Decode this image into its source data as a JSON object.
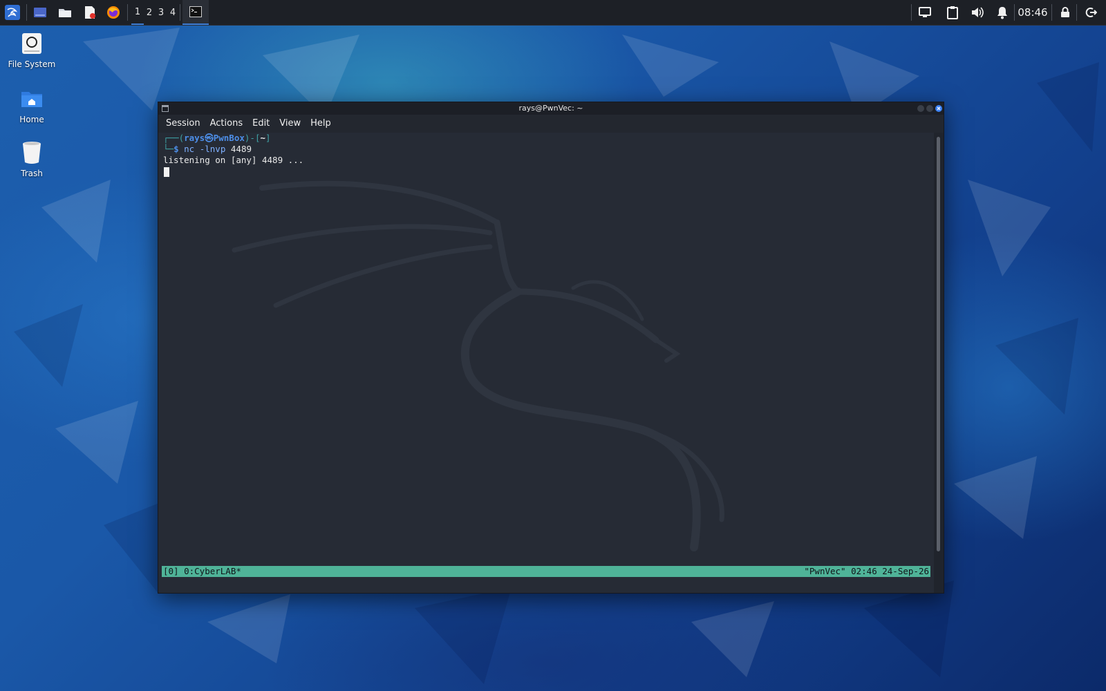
{
  "panel": {
    "workspaces": [
      "1",
      "2",
      "3",
      "4"
    ],
    "active_workspace": "1",
    "clock": "08:46",
    "launchers": [
      "kali-menu-icon",
      "desktop-icon",
      "file-manager-icon",
      "text-editor-icon",
      "firefox-icon"
    ],
    "tray": [
      "display-icon",
      "clipboard-icon",
      "volume-icon",
      "notification-icon",
      "lock-icon",
      "logout-icon"
    ]
  },
  "desktop": {
    "icons": [
      {
        "label": "File System",
        "icon": "drive-icon"
      },
      {
        "label": "Home",
        "icon": "home-folder-icon"
      },
      {
        "label": "Trash",
        "icon": "trash-icon"
      }
    ]
  },
  "window": {
    "title": "rays@PwnVec: ~",
    "menu": [
      "Session",
      "Actions",
      "Edit",
      "View",
      "Help"
    ]
  },
  "terminal": {
    "prompt_prefix": "┌──(",
    "user": "rays",
    "at_symbol": "㉿",
    "host": "PwnBox",
    "prompt_mid": ")-[",
    "cwd": "~",
    "prompt_end": "]",
    "prompt_line2_prefix": "└─",
    "dollar": "$",
    "cmd_name": "nc",
    "cmd_flag": "-lnvp",
    "cmd_arg": "4489",
    "output": "listening on [any] 4489 ..."
  },
  "tmux": {
    "left": "[0] 0:CyberLAB*",
    "right": "\"PwnVec\" 02:46 24-Sep-26"
  },
  "colors": {
    "accent": "#3a7bd5",
    "tmux_bar": "#4fb398",
    "prompt_user": "#4d8ee8",
    "prompt_frame": "#3fa3a6",
    "close_button": "#3b82f6"
  }
}
